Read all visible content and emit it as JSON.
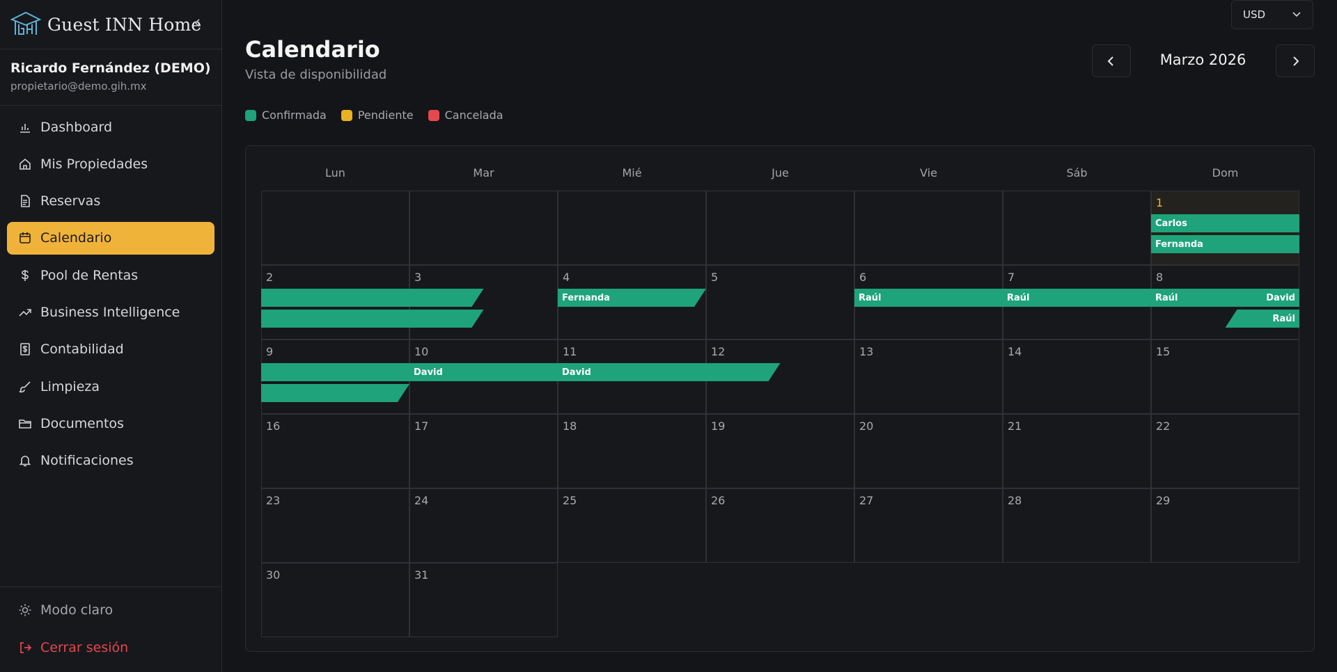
{
  "brand": {
    "name": "Guest INN Home"
  },
  "user": {
    "name": "Ricardo Fernández (DEMO)",
    "email": "propietario@demo.gih.mx"
  },
  "nav": [
    {
      "label": "Dashboard",
      "icon": "bar-chart-icon",
      "active": false
    },
    {
      "label": "Mis Propiedades",
      "icon": "home-icon",
      "active": false
    },
    {
      "label": "Reservas",
      "icon": "document-icon",
      "active": false
    },
    {
      "label": "Calendario",
      "icon": "calendar-icon",
      "active": true
    },
    {
      "label": "Pool de Rentas",
      "icon": "dollar-icon",
      "active": false
    },
    {
      "label": "Business Intelligence",
      "icon": "trending-up-icon",
      "active": false
    },
    {
      "label": "Contabilidad",
      "icon": "receipt-icon",
      "active": false
    },
    {
      "label": "Limpieza",
      "icon": "brush-icon",
      "active": false
    },
    {
      "label": "Documentos",
      "icon": "folder-icon",
      "active": false
    },
    {
      "label": "Notificaciones",
      "icon": "bell-icon",
      "active": false
    }
  ],
  "sidebar_bottom": {
    "theme": "Modo claro",
    "logout": "Cerrar sesión"
  },
  "currency": "USD",
  "page": {
    "title": "Calendario",
    "subtitle": "Vista de disponibilidad",
    "month": "Marzo 2026"
  },
  "legend": [
    {
      "label": "Confirmada",
      "color": "#1ea37a"
    },
    {
      "label": "Pendiente",
      "color": "#e9b021"
    },
    {
      "label": "Cancelada",
      "color": "#e5484d"
    }
  ],
  "weekdays": [
    "Lun",
    "Mar",
    "Mié",
    "Jue",
    "Vie",
    "Sáb",
    "Dom"
  ],
  "calendar": {
    "first_weekday": 6,
    "days_in_month": 31,
    "today": 1
  },
  "reservations": [
    {
      "guest": "Carlos",
      "start": 0,
      "end": 5,
      "lane": 0
    },
    {
      "guest": "Fernanda",
      "start": 0,
      "end": 5,
      "lane": 1
    },
    {
      "guest": "Fernanda",
      "start": 6,
      "end": 8,
      "lane": 0
    },
    {
      "guest": "Raúl",
      "start": 10,
      "end": 17,
      "lane": 0
    },
    {
      "guest": "David",
      "start": 15,
      "end": 23,
      "lane": 0
    },
    {
      "guest": "Raúl",
      "start": 15,
      "end": 18,
      "lane": 1
    }
  ],
  "colors": {
    "confirmed": "#1ea37a",
    "accent": "#f0b33a",
    "danger": "#e5484d"
  }
}
